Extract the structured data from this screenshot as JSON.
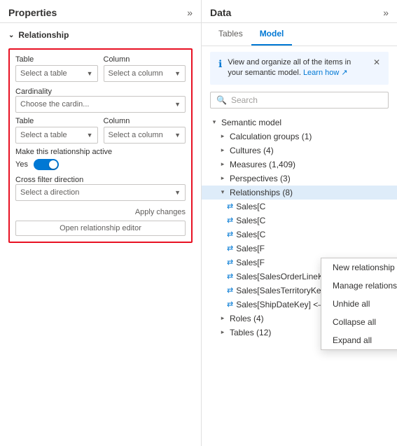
{
  "left_panel": {
    "title": "Properties",
    "expand_icon": "»",
    "section": {
      "label": "Relationship"
    },
    "table1": {
      "label": "Table",
      "placeholder": "Select a table"
    },
    "column1": {
      "label": "Column",
      "placeholder": "Select a column"
    },
    "cardinality": {
      "label": "Cardinality",
      "placeholder": "Choose the cardin..."
    },
    "table2": {
      "label": "Table",
      "placeholder": "Select a table"
    },
    "column2": {
      "label": "Column",
      "placeholder": "Select a column"
    },
    "active": {
      "label": "Make this relationship active",
      "yes": "Yes"
    },
    "cross_filter": {
      "label": "Cross filter direction",
      "placeholder": "Select a direction"
    },
    "apply_btn": "Apply changes",
    "open_editor_btn": "Open relationship editor"
  },
  "right_panel": {
    "title": "Data",
    "expand_icon": "»",
    "tabs": [
      {
        "label": "Tables",
        "active": false
      },
      {
        "label": "Model",
        "active": true
      }
    ],
    "info": {
      "text": "View and organize all of the items in your semantic model.",
      "link": "Learn how"
    },
    "search": {
      "placeholder": "Search"
    },
    "tree": {
      "root": "Semantic model",
      "items": [
        {
          "label": "Calculation groups (1)",
          "indent": 1,
          "expanded": false
        },
        {
          "label": "Cultures (4)",
          "indent": 1,
          "expanded": false
        },
        {
          "label": "Measures (1,409)",
          "indent": 1,
          "expanded": false
        },
        {
          "label": "Perspectives (3)",
          "indent": 1,
          "expanded": false
        },
        {
          "label": "Relationships (8)",
          "indent": 1,
          "expanded": true,
          "highlighted": true
        },
        {
          "label": "Sales[C",
          "indent": 2,
          "icon": "rel"
        },
        {
          "label": "Sales[C",
          "indent": 2,
          "icon": "rel"
        },
        {
          "label": "Sales[C",
          "indent": 2,
          "icon": "rel"
        },
        {
          "label": "Sales[F",
          "indent": 2,
          "icon": "rel"
        },
        {
          "label": "Sales[F",
          "indent": 2,
          "icon": "rel"
        },
        {
          "label": "Sales[SalesOrderLineKey] — Sales Or...",
          "indent": 2,
          "icon": "rel"
        },
        {
          "label": "Sales[SalesTerritoryKey] <— Sales Te...",
          "indent": 2,
          "icon": "rel"
        },
        {
          "label": "Sales[ShipDateKey] <— Date[DateKey]",
          "indent": 2,
          "icon": "rel"
        },
        {
          "label": "Roles (4)",
          "indent": 1,
          "expanded": false
        },
        {
          "label": "Tables (12)",
          "indent": 1,
          "expanded": false
        }
      ]
    },
    "context_menu": {
      "items": [
        "New relationship",
        "Manage relationships",
        "Unhide all",
        "Collapse all",
        "Expand all"
      ]
    }
  }
}
